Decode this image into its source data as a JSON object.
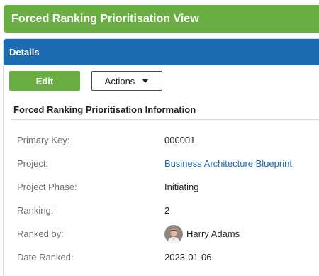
{
  "title_bar": {
    "title": "Forced Ranking Prioritisation View"
  },
  "panel": {
    "header": "Details"
  },
  "toolbar": {
    "edit_label": "Edit",
    "actions_label": "Actions"
  },
  "section": {
    "title": "Forced Ranking Prioritisation Information"
  },
  "fields": {
    "primary_key": {
      "label": "Primary Key:",
      "value": "000001"
    },
    "project": {
      "label": "Project:",
      "value": "Business Architecture Blueprint"
    },
    "project_phase": {
      "label": "Project Phase:",
      "value": "Initiating"
    },
    "ranking": {
      "label": "Ranking:",
      "value": "2"
    },
    "ranked_by": {
      "label": "Ranked by:",
      "value": "Harry Adams"
    },
    "date_ranked": {
      "label": "Date Ranked:",
      "value": "2023-01-06"
    }
  },
  "colors": {
    "title_bar": "#6aae43",
    "panel_header": "#1c6bb0",
    "link": "#1c6bb0",
    "edit_button": "#6aae43"
  },
  "icons": {
    "actions_dropdown": "caret-down-icon",
    "ranked_by_avatar": "user-avatar"
  }
}
